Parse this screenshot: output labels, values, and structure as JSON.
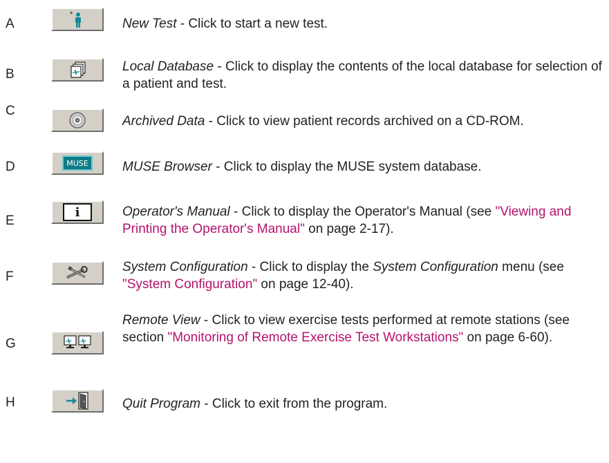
{
  "rows": [
    {
      "letter": "A",
      "title": "New Test",
      "sep": " - ",
      "text": "Click to start a new test.",
      "icon": "new-patient-icon"
    },
    {
      "letter": "B",
      "title": "Local Database",
      "sep": " - ",
      "text": "Click to display the contents of the local database for selection of a patient and test.",
      "icon": "local-database-icon"
    },
    {
      "letter": "C",
      "title": "Archived Data",
      "sep": " - ",
      "text": "Click to view patient records archived on a CD-ROM.",
      "icon": "cd-rom-icon"
    },
    {
      "letter": "D",
      "title": "MUSE Browser",
      "sep": " - ",
      "text": "Click to display the MUSE system database.",
      "icon": "muse-icon",
      "icon_text": "MUSE"
    },
    {
      "letter": "E",
      "title": "Operator's Manual",
      "sep": " - ",
      "text_before": "Click to display the Operator's Manual (see ",
      "link": "\"Viewing and Printing the Operator's Manual\"",
      "text_after": " on page 2-17).",
      "icon": "info-icon",
      "icon_text": "i"
    },
    {
      "letter": "F",
      "title": "System Configuration",
      "sep": " - ",
      "text_before": "Click to display the ",
      "title2": "System Configuration",
      "text_mid": " menu (see ",
      "link": "\"System Configuration\"",
      "text_after": " on page 12-40).",
      "icon": "tools-icon"
    },
    {
      "letter": "G",
      "title": "Remote View",
      "sep": " - ",
      "text_before": "Click to view exercise tests performed at remote stations (see section ",
      "link": "\"Monitoring of Remote Exercise Test Workstations\"",
      "text_after": " on page 6-60).",
      "icon": "remote-monitors-icon"
    },
    {
      "letter": "H",
      "title": "Quit Program",
      "sep": " - ",
      "text": "Click to exit from the program.",
      "icon": "exit-door-icon"
    }
  ],
  "colors": {
    "link": "#b4126e",
    "muse_bg": "#0f7c86",
    "person": "#0f8a99",
    "button": "#d4d0c8"
  }
}
